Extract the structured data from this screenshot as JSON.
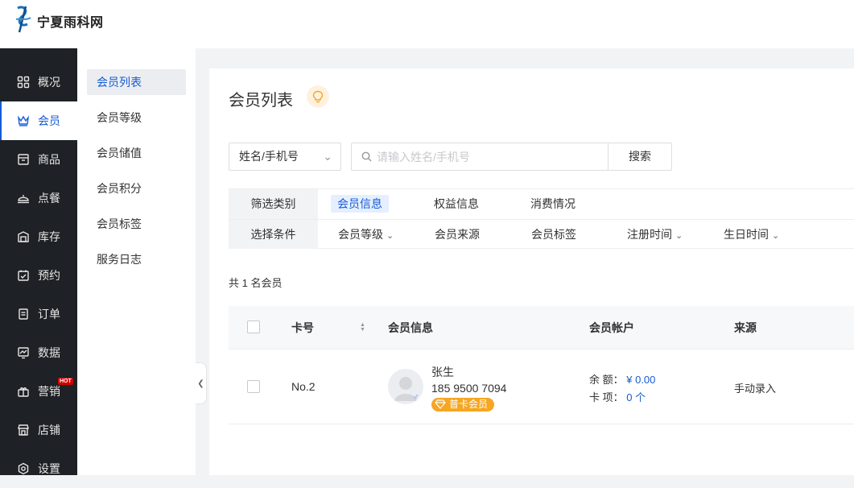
{
  "brand": {
    "name": "宁夏雨科网"
  },
  "nav": {
    "items": [
      {
        "label": "概况",
        "icon": "grid-icon"
      },
      {
        "label": "会员",
        "icon": "crown-icon"
      },
      {
        "label": "商品",
        "icon": "store-icon"
      },
      {
        "label": "点餐",
        "icon": "cloche-icon"
      },
      {
        "label": "库存",
        "icon": "inventory-icon"
      },
      {
        "label": "预约",
        "icon": "calendar-check-icon"
      },
      {
        "label": "订单",
        "icon": "order-icon"
      },
      {
        "label": "数据",
        "icon": "chart-icon"
      },
      {
        "label": "营销",
        "icon": "gift-icon",
        "badge": "HOT"
      },
      {
        "label": "店铺",
        "icon": "shop-icon"
      },
      {
        "label": "设置",
        "icon": "settings-icon"
      }
    ],
    "active": "会员"
  },
  "subnav": {
    "items": [
      "会员列表",
      "会员等级",
      "会员储值",
      "会员积分",
      "会员标签",
      "服务日志"
    ],
    "active": "会员列表"
  },
  "page": {
    "title": "会员列表"
  },
  "search": {
    "type_value": "姓名/手机号",
    "placeholder": "请输入姓名/手机号",
    "button": "搜索"
  },
  "filter": {
    "category_label": "筛选类别",
    "categories": [
      "会员信息",
      "权益信息",
      "消费情况"
    ],
    "active_category": "会员信息",
    "condition_label": "选择条件",
    "conditions": [
      "会员等级",
      "会员来源",
      "会员标签",
      "注册时间",
      "生日时间"
    ]
  },
  "summary": {
    "count_text": "共 1 名会员"
  },
  "table": {
    "columns": [
      "卡号",
      "会员信息",
      "会员帐户",
      "来源"
    ],
    "rows": [
      {
        "card_no": "No.2",
        "name": "张生",
        "phone": "185 9500 7094",
        "gender": "♂",
        "level": "普卡会员",
        "balance_label": "余 额：",
        "balance": "¥ 0.00",
        "cards_label": "卡 项：",
        "cards": "0 个",
        "source": "手动录入"
      }
    ]
  },
  "colors": {
    "primary": "#155bd4",
    "nav_bg": "#1e2125",
    "badge": "#f5a623",
    "hot": "#d40000"
  }
}
